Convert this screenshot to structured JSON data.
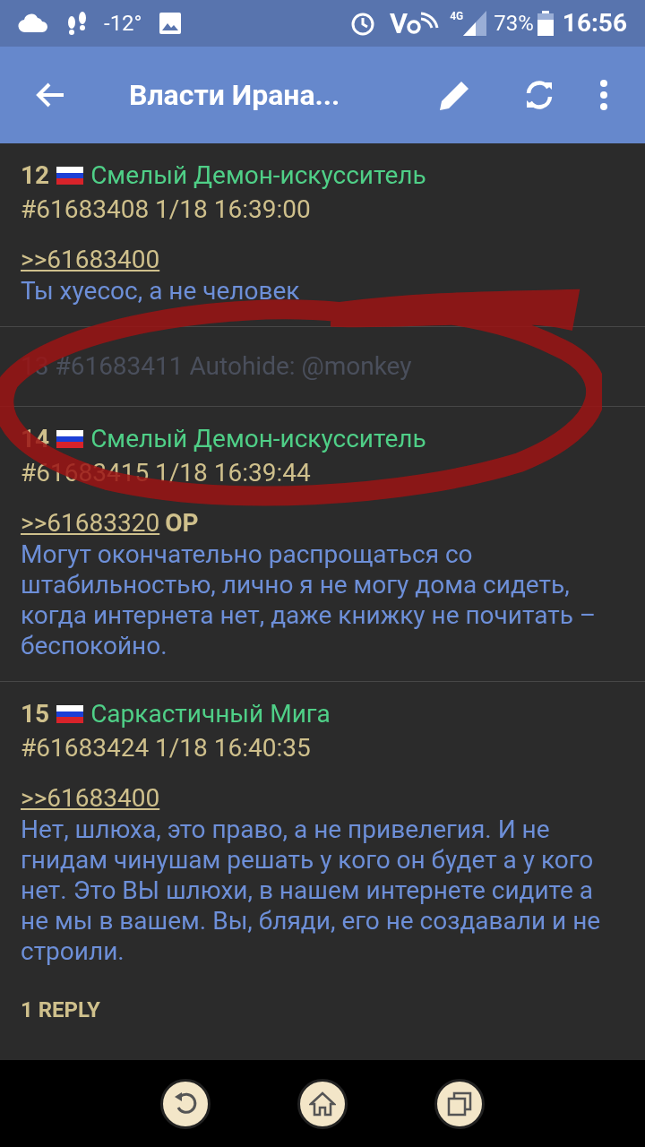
{
  "status_bar": {
    "temperature": "-12°",
    "network": "4G",
    "battery": "73%",
    "time": "16:56"
  },
  "toolbar": {
    "title": "Власти Ирана..."
  },
  "posts": [
    {
      "kind": "post",
      "number": "12",
      "name": "Смелый Демон-искусситель",
      "meta": "#61683408 1/18 16:39:00",
      "quote": ">>61683400",
      "body": "Ты хуесос, а не человек"
    },
    {
      "kind": "hidden",
      "text": "13 #61683411 Autohide: @monkey"
    },
    {
      "kind": "post",
      "number": "14",
      "name": "Смелый Демон-искусситель",
      "meta": "#61683415 1/18 16:39:44",
      "quote": ">>61683320",
      "op": "OP",
      "body": "Могут окончательно распрощаться со штабильностью, лично я не могу дома сидеть, когда интернета нет, даже книжку не почитать – беспокойно."
    },
    {
      "kind": "post",
      "number": "15",
      "name": "Саркастичный Мига",
      "meta": "#61683424 1/18 16:40:35",
      "quote": ">>61683400",
      "body": "Нет, шлюха, это право, а не привелегия. И не гнидам чинушам решать у кого он будет а у кого нет. Это ВЫ шлюхи, в нашем интернете сидите а не мы в вашем. Вы, бляди, его не создавали и не строили.",
      "replies": "1 REPLY"
    }
  ]
}
